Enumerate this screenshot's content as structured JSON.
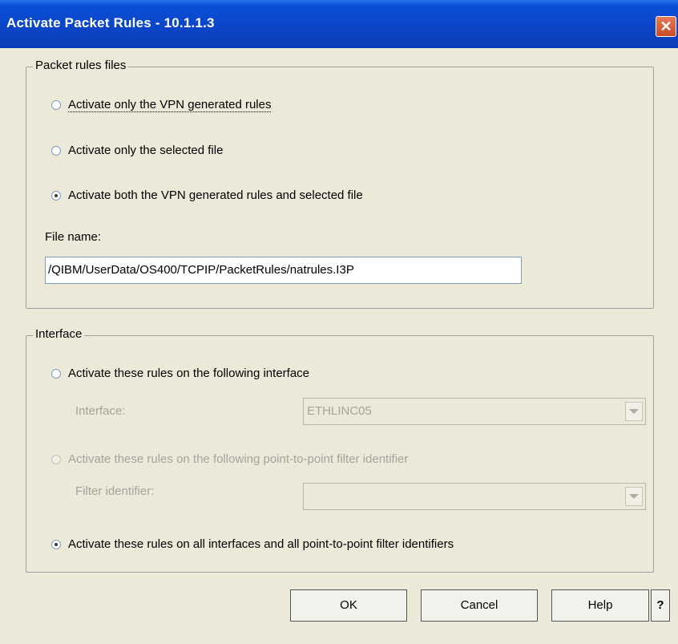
{
  "window": {
    "title": "Activate Packet Rules - 10.1.1.3",
    "close_glyph": "✕"
  },
  "packet_rules": {
    "legend": "Packet rules files",
    "options": [
      {
        "label": "Activate only the VPN generated rules",
        "checked": false
      },
      {
        "label": "Activate only the selected file",
        "checked": false
      },
      {
        "label": "Activate both the VPN generated rules and selected file",
        "checked": true
      }
    ],
    "file_name_label": "File name:",
    "file_name_value": "/QIBM/UserData/OS400/TCPIP/PacketRules/natrules.I3P"
  },
  "interface": {
    "legend": "Interface",
    "option_interface": "Activate these rules on the following interface",
    "interface_label": "Interface:",
    "interface_value": "ETHLINC05",
    "option_ptp": "Activate these rules on the following point-to-point filter identifier",
    "filter_label": "Filter identifier:",
    "filter_value": "",
    "option_all": "Activate these rules on all interfaces and all point-to-point filter identifiers",
    "selected": "all"
  },
  "buttons": {
    "ok": "OK",
    "cancel": "Cancel",
    "help": "Help",
    "whats_this": "?"
  }
}
